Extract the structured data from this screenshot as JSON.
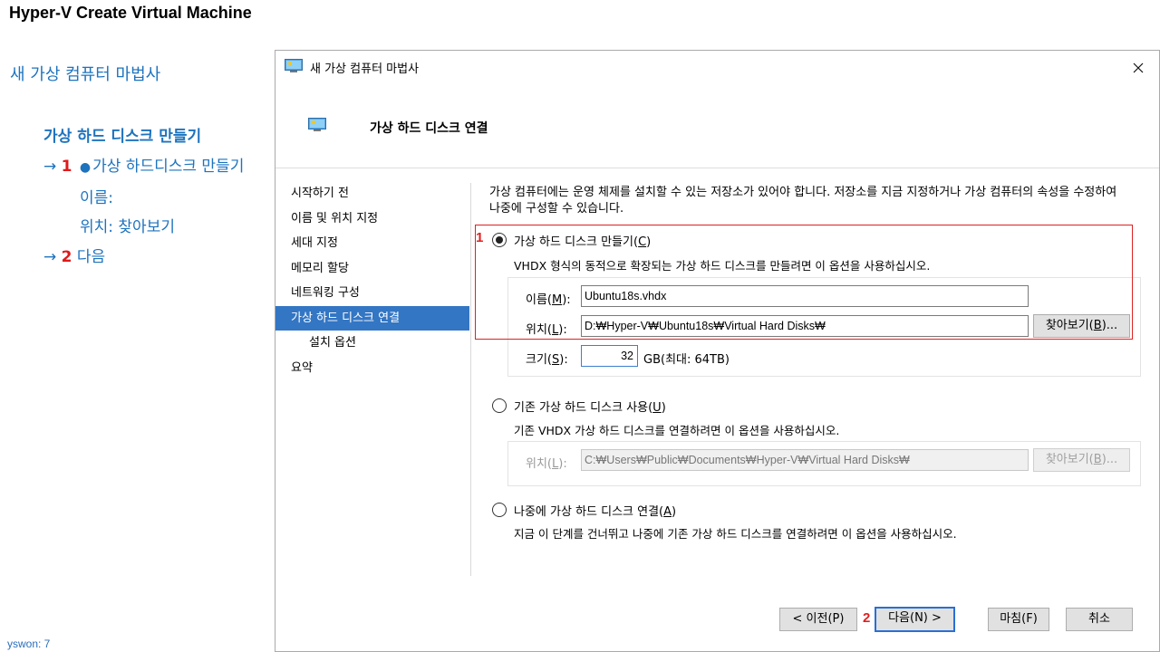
{
  "page": {
    "title": "Hyper-V Create Virtual Machine",
    "footer": "yswon:   7"
  },
  "notes": {
    "heading": "새 가상 컴퓨터 마법사",
    "subheading": "가상 하드 디스크 만들기",
    "step1": {
      "arrow": "→",
      "num": "1",
      "dot": "●",
      "text": "가상 하드디스크 만들기"
    },
    "items": [
      "이름:",
      "위치: 찾아보기"
    ],
    "step2": {
      "arrow": "→",
      "num": "2",
      "text": "다음"
    }
  },
  "dialog": {
    "title": "새 가상 컴퓨터 마법사",
    "close_icon": "close-icon",
    "header_title": "가상 하드 디스크 연결",
    "nav": [
      {
        "label": "시작하기 전",
        "active": false,
        "sub": false
      },
      {
        "label": "이름 및 위치 지정",
        "active": false,
        "sub": false
      },
      {
        "label": "세대 지정",
        "active": false,
        "sub": false
      },
      {
        "label": "메모리 할당",
        "active": false,
        "sub": false
      },
      {
        "label": "네트워킹 구성",
        "active": false,
        "sub": false
      },
      {
        "label": "가상 하드 디스크 연결",
        "active": true,
        "sub": false
      },
      {
        "label": "설치 옵션",
        "active": false,
        "sub": true
      },
      {
        "label": "요약",
        "active": false,
        "sub": false
      }
    ],
    "description": "가상 컴퓨터에는 운영 체제를 설치할 수 있는 저장소가 있어야 합니다. 저장소를 지금 지정하거나 가상 컴퓨터의 속성을 수정하여 나중에 구성할 수 있습니다.",
    "option_create": {
      "label": "가상 하드 디스크 만들기(",
      "accel": "C",
      "label_end": ")",
      "desc": "VHDX 형식의 동적으로 확장되는 가상 하드 디스크를 만들려면 이 옵션을 사용하십시오.",
      "name_label": "이름(",
      "name_accel": "M",
      "name_value": "Ubuntu18s.vhdx",
      "location_label": "위치(",
      "location_accel": "L",
      "location_value": "D:₩Hyper-V₩Ubuntu18s₩Virtual Hard Disks₩",
      "browse_label": "찾아보기(",
      "browse_accel": "B",
      "browse_end": ")...",
      "size_label": "크기(",
      "size_accel": "S",
      "size_value": "32",
      "size_unit": "GB(최대: 64TB)",
      "selected": true
    },
    "option_existing": {
      "label": "기존 가상 하드 디스크 사용(",
      "accel": "U",
      "label_end": ")",
      "desc": "기존 VHDX 가상 하드 디스크를 연결하려면 이 옵션을 사용하십시오.",
      "location_label": "위치(",
      "location_accel": "L",
      "location_value": "C:₩Users₩Public₩Documents₩Hyper-V₩Virtual Hard Disks₩",
      "browse_label": "찾아보기(",
      "browse_accel": "B",
      "browse_end": ")...",
      "selected": false
    },
    "option_later": {
      "label": "나중에 가상 하드 디스크 연결(",
      "accel": "A",
      "label_end": ")",
      "desc": "지금 이 단계를 건너뛰고 나중에 기존 가상 하드 디스크를 연결하려면 이 옵션을 사용하십시오.",
      "selected": false
    },
    "buttons": {
      "prev": "< 이전(P)",
      "next": "다음(N) >",
      "finish": "마침(F)",
      "cancel": "취소"
    },
    "annotations": {
      "one": "1",
      "two": "2"
    }
  },
  "colors": {
    "accent": "#3376c4",
    "notes": "#1e73be",
    "annotation": "#dd2222"
  }
}
